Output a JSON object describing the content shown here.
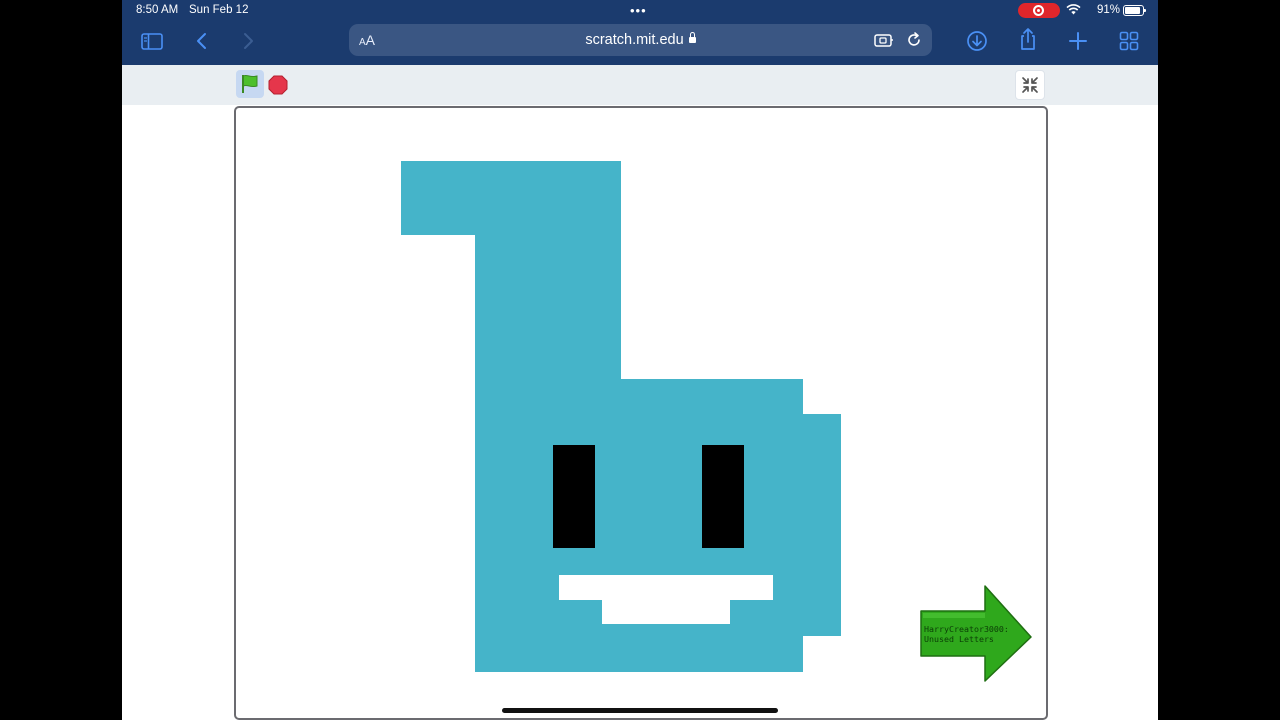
{
  "status_bar": {
    "time": "8:50 AM",
    "date": "Sun Feb 12",
    "battery": "91%"
  },
  "toolbar": {
    "reader_label_small": "A",
    "reader_label_large": "A",
    "url": "scratch.mit.edu",
    "icons": [
      "sidebar-icon",
      "back-icon",
      "forward-icon",
      "extension-icon",
      "reload-icon",
      "download-icon",
      "share-icon",
      "new-tab-icon",
      "tabs-overview-icon"
    ]
  },
  "scratch_player": {
    "controls": [
      "green-flag",
      "stop",
      "exit-fullscreen"
    ],
    "stage": {
      "character_color": "#45b4c9",
      "next_button": {
        "line1": "HarryCreator3000:",
        "line2": "Unused Letters",
        "color": "#2fa81c"
      }
    }
  },
  "colors": {
    "chrome": "#1b3b6e",
    "url_bar": "#3a5683",
    "accent_blue": "#4a90f5",
    "record": "#e0262b"
  }
}
